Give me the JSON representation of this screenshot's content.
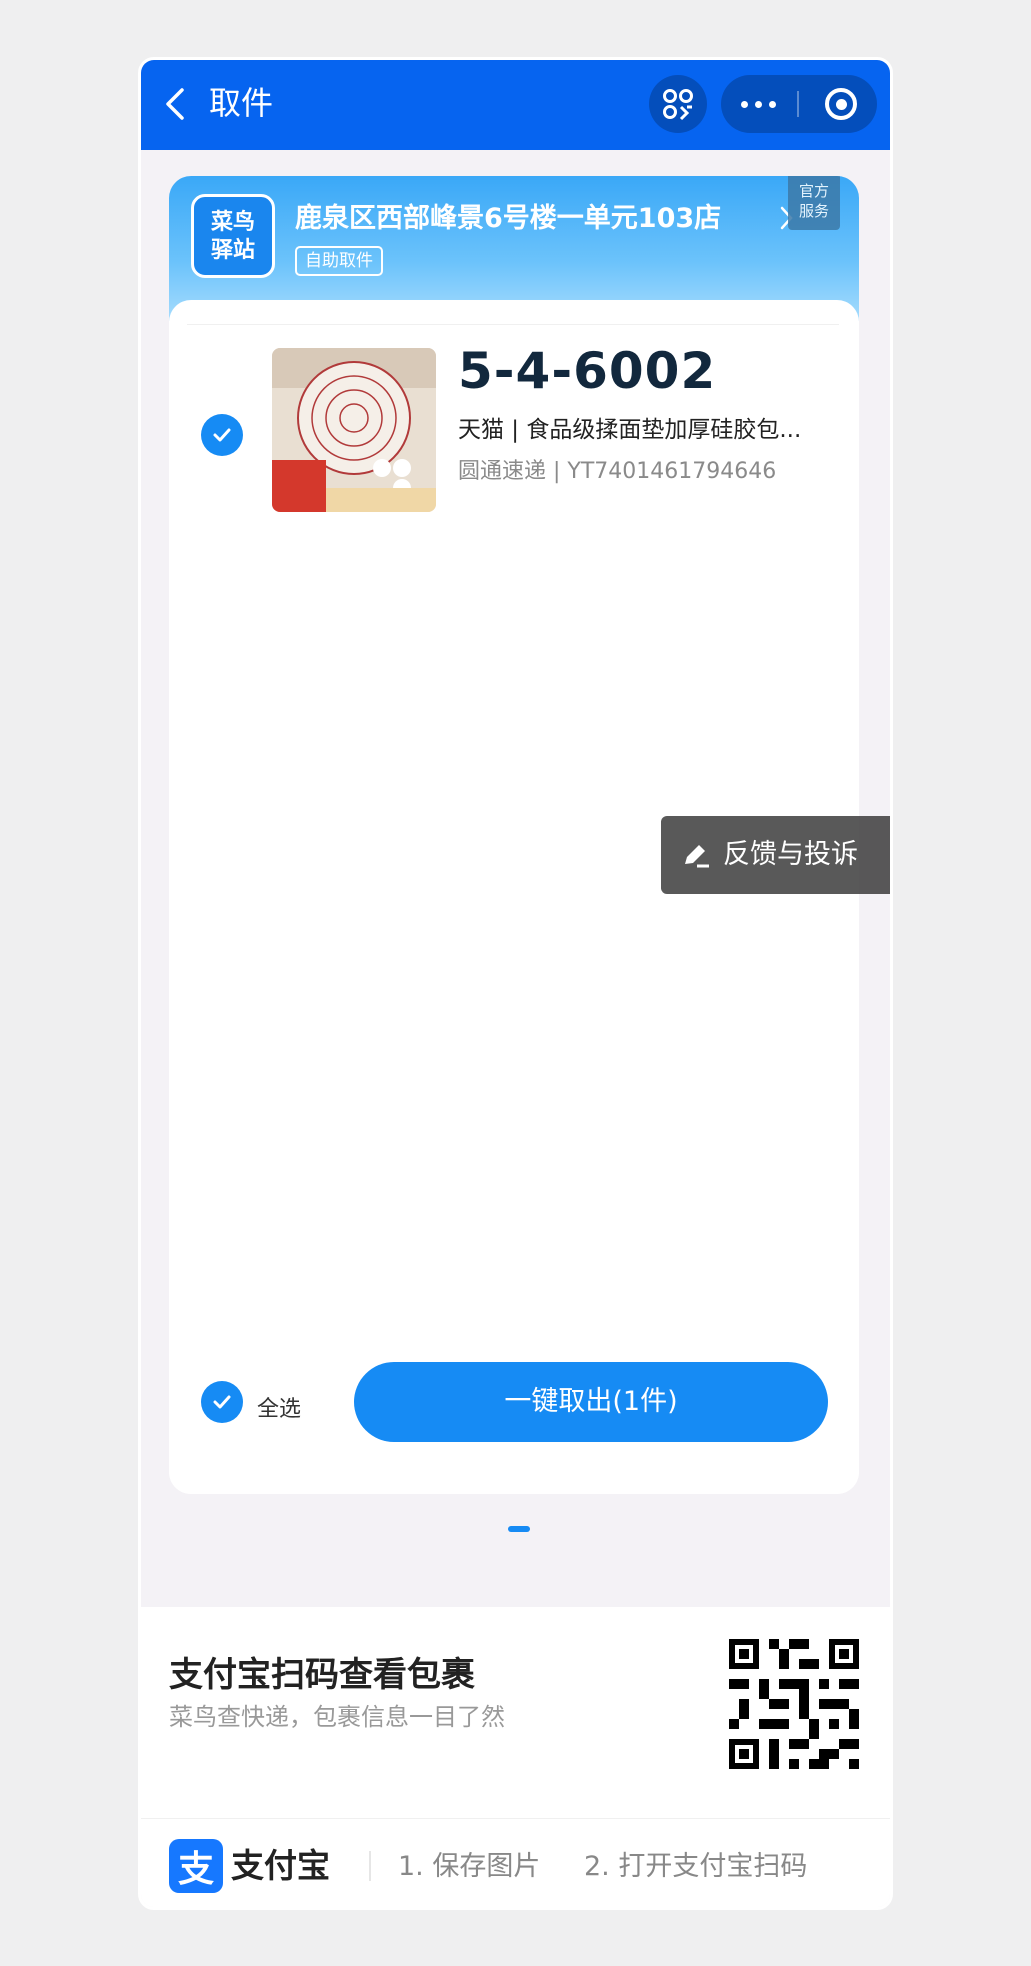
{
  "navbar": {
    "title": "取件",
    "accent": "#0664f0"
  },
  "station": {
    "logo_line1": "菜鸟",
    "logo_line2": "驿站",
    "name": "鹿泉区西部峰景6号楼一单元103店",
    "tag": "自助取件",
    "official_line1": "官方",
    "official_line2": "服务"
  },
  "package": {
    "pickup_code": "5-4-6002",
    "description": "天猫 | 食品级揉面垫加厚硅胶包...",
    "tracking": "圆通速递 | YT7401461794646",
    "checked": true
  },
  "footer_actions": {
    "select_all_label": "全选",
    "pickup_button_label": "一键取出(1件)"
  },
  "feedback_label": "反馈与投诉",
  "promo": {
    "title": "支付宝扫码查看包裹",
    "subtitle": "菜鸟查快递，包裹信息一目了然",
    "brand_glyph": "支",
    "brand_name": "支付宝",
    "step1": "1. 保存图片",
    "step2": "2. 打开支付宝扫码"
  }
}
